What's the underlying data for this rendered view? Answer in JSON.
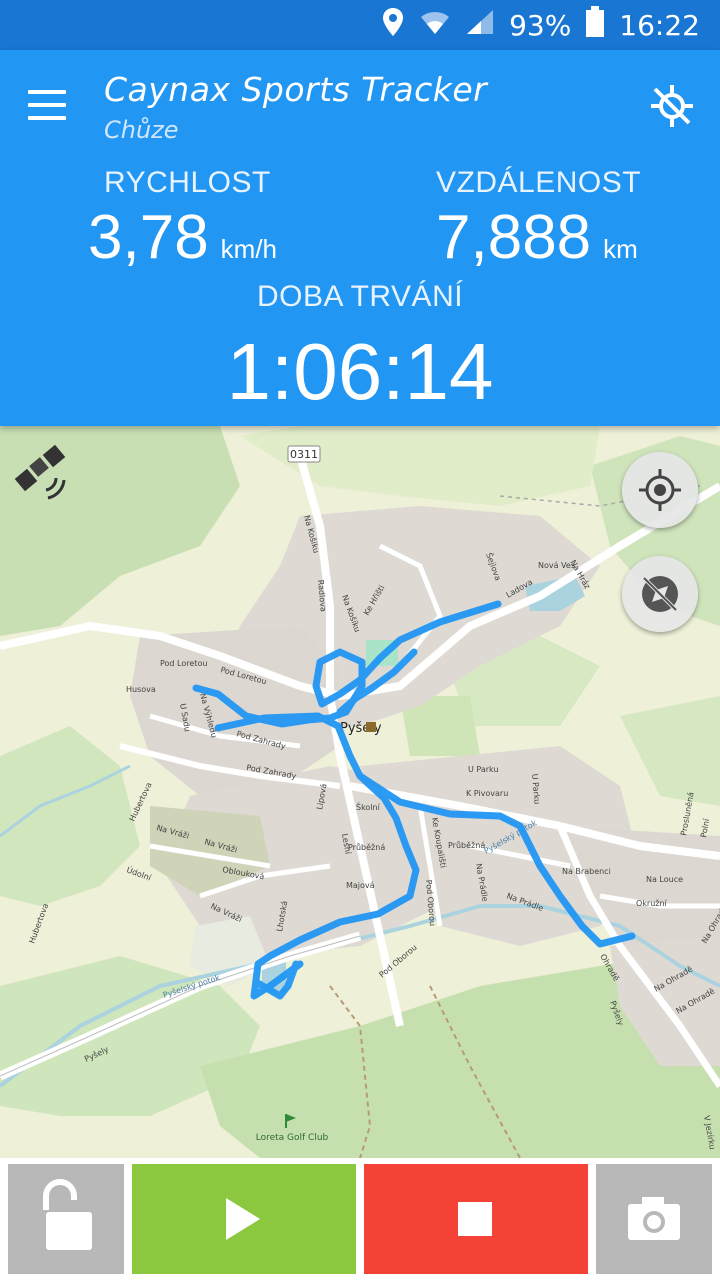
{
  "status_bar": {
    "battery": "93%",
    "time": "16:22"
  },
  "header": {
    "title": "Caynax Sports Tracker",
    "activity": "Chůze"
  },
  "stats": {
    "speed": {
      "label": "RYCHLOST",
      "value": "3,78",
      "unit": "km/h"
    },
    "distance": {
      "label": "VZDÁLENOST",
      "value": "7,888",
      "unit": "km"
    },
    "duration": {
      "label": "DOBA TRVÁNÍ",
      "value": "1:06:14"
    }
  },
  "map": {
    "road_badge": "0311",
    "streets": [
      "Na Košiku",
      "Ke Hřišti",
      "Na Košíku",
      "Šejlova",
      "Ladova",
      "Nová Ves",
      "Na Hráz",
      "Radlova",
      "Pod Loretou",
      "Pod Loretou",
      "Husova",
      "U Sadu",
      "Na Výhledu",
      "Pod Zahrady",
      "Pod Zahrady",
      "Hubertova",
      "Na Vráži",
      "Na Vráži",
      "Údolní",
      "Oblouková",
      "Na Vráži",
      "Hubertova",
      "Pyšelský potok",
      "Pyšely",
      "Lipová",
      "Lesní",
      "Školní",
      "Průběžná",
      "Majová",
      "Lhotská",
      "Ke Koupališti",
      "Průběžná",
      "Na Prádle",
      "Pyšelský potok",
      "Na Prádle",
      "Pod Oborou",
      "Pod Oborou",
      "U Parku",
      "K Pivovaru",
      "U Parku",
      "Na Brabenci",
      "Na Louce",
      "Okružní",
      "Prosluněná",
      "Polní",
      "Ohradě",
      "Na Ohradě",
      "Na Ohradě",
      "Na Ohradě",
      "Pyšely",
      "V Jezírku"
    ],
    "town_label": "Pyšely",
    "poi_label": "Loreta Golf Club"
  },
  "controls": {
    "lock_icon": "unlock-icon",
    "play_icon": "play-icon",
    "stop_icon": "stop-icon",
    "camera_icon": "camera-icon"
  },
  "colors": {
    "status_bar": "#1976d2",
    "app_bar": "#2196f3",
    "track": "#2196f3",
    "play": "#8bc83f",
    "stop": "#f44336",
    "side_button": "#b8b8b8"
  }
}
